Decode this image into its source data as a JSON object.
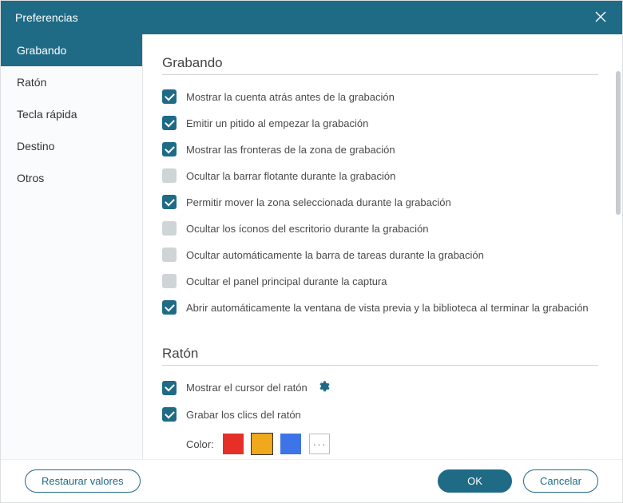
{
  "header": {
    "title": "Preferencias"
  },
  "sidebar": {
    "items": [
      {
        "label": "Grabando",
        "active": true
      },
      {
        "label": "Ratón"
      },
      {
        "label": "Tecla rápida"
      },
      {
        "label": "Destino"
      },
      {
        "label": "Otros"
      }
    ]
  },
  "sections": {
    "recording": {
      "title": "Grabando",
      "options": [
        {
          "checked": true,
          "label": "Mostrar la cuenta atrás antes de la grabación"
        },
        {
          "checked": true,
          "label": "Emitir un pitido al empezar la grabación"
        },
        {
          "checked": true,
          "label": "Mostrar las fronteras de la zona de grabación"
        },
        {
          "checked": false,
          "label": "Ocultar la barrar flotante durante la grabación"
        },
        {
          "checked": true,
          "label": "Permitir mover la zona seleccionada durante la grabación"
        },
        {
          "checked": false,
          "label": "Ocultar los íconos del escritorio durante la grabación"
        },
        {
          "checked": false,
          "label": "Ocultar automáticamente la barra de tareas durante la grabación"
        },
        {
          "checked": false,
          "label": "Ocultar el panel principal durante la captura"
        },
        {
          "checked": true,
          "label": "Abrir automáticamente la ventana de vista previa y la biblioteca al terminar la grabación"
        }
      ]
    },
    "mouse": {
      "title": "Ratón",
      "options": [
        {
          "checked": true,
          "label": "Mostrar el cursor del ratón",
          "gear": true
        },
        {
          "checked": true,
          "label": "Grabar los clics del ratón"
        }
      ],
      "color_label": "Color:",
      "colors": [
        {
          "name": "red",
          "hex": "#e72f2a"
        },
        {
          "name": "yellow",
          "hex": "#f0a81c",
          "selected": true
        },
        {
          "name": "blue",
          "hex": "#3d75e8"
        },
        {
          "name": "more",
          "glyph": "···"
        }
      ]
    }
  },
  "footer": {
    "restore": "Restaurar valores",
    "ok": "OK",
    "cancel": "Cancelar"
  }
}
